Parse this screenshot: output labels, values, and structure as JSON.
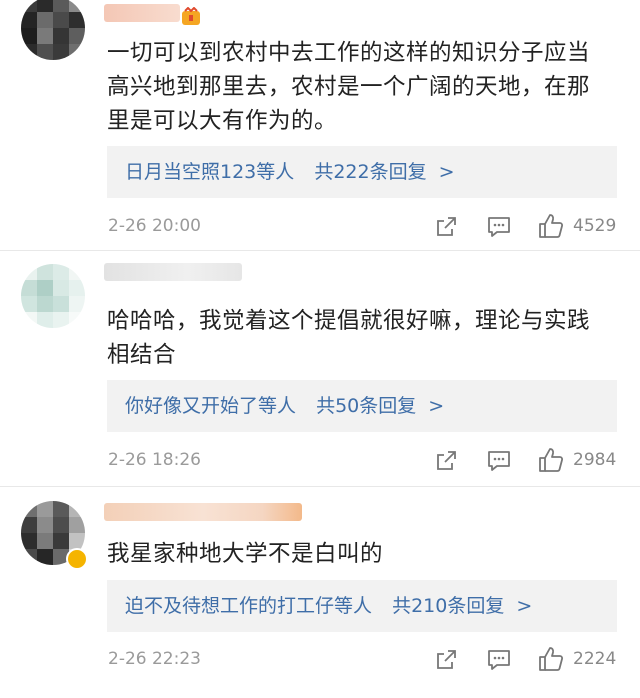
{
  "comments": [
    {
      "content_lines": [
        "一切可以到农村中去工作的这样的知识分子应当",
        "高兴地到那里去，农村是一个广阔的天地，在那",
        "里是可以大有作为的。"
      ],
      "reply_users": "日月当空照123等人",
      "reply_count": "共222条回复",
      "reply_chevron": ">",
      "time": "2-26 20:00",
      "likes": "4529"
    },
    {
      "content_lines": [
        "哈哈哈，我觉着这个提倡就很好嘛，理论与实践",
        "相结合"
      ],
      "reply_users": "你好像又开始了等人",
      "reply_count": "共50条回复",
      "reply_chevron": ">",
      "time": "2-26 18:26",
      "likes": "2984"
    },
    {
      "content_lines": [
        "我星家种地大学不是白叫的"
      ],
      "reply_users": "迫不及待想工作的打工仔等人",
      "reply_count": "共210条回复",
      "reply_chevron": ">",
      "time": "2-26 22:23",
      "likes": "2224"
    }
  ],
  "icons": {
    "share": "share-icon",
    "comment": "comment-icon",
    "like": "thumbs-up-icon",
    "badge": "vip-badge-icon"
  },
  "colors": {
    "link": "#3f6ea8",
    "meta": "#9a9a9a",
    "reply_bg": "#f2f2f2"
  }
}
